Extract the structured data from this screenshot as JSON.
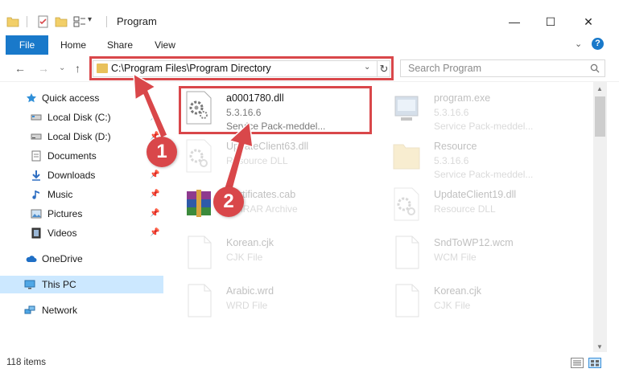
{
  "window": {
    "title": "Program",
    "minimize_glyph": "—",
    "maximize_glyph": "☐",
    "close_glyph": "✕"
  },
  "ribbon": {
    "tabs": [
      "File",
      "Home",
      "Share",
      "View"
    ],
    "collapse_glyph": "⌄",
    "help_glyph": "?"
  },
  "nav": {
    "back_glyph": "←",
    "forward_glyph": "→",
    "recent_glyph": "⌄",
    "up_glyph": "↑",
    "address_path": "C:\\Program Files\\Program Directory",
    "address_dropdown_glyph": "⌄",
    "refresh_glyph": "↻",
    "search_placeholder": "Search Program"
  },
  "sidebar": {
    "items": [
      {
        "label": "Quick access",
        "icon": "star-icon"
      },
      {
        "label": "Local Disk (C:)",
        "icon": "drive-icon"
      },
      {
        "label": "Local Disk (D:)",
        "icon": "drive-icon"
      },
      {
        "label": "Documents",
        "icon": "documents-icon"
      },
      {
        "label": "Downloads",
        "icon": "download-icon"
      },
      {
        "label": "Music",
        "icon": "music-icon"
      },
      {
        "label": "Pictures",
        "icon": "pictures-icon"
      },
      {
        "label": "Videos",
        "icon": "videos-icon"
      },
      {
        "label": "OneDrive",
        "icon": "cloud-icon"
      },
      {
        "label": "This PC",
        "icon": "monitor-icon"
      },
      {
        "label": "Network",
        "icon": "network-icon"
      }
    ],
    "pin_glyph": "📌"
  },
  "files": [
    {
      "name": "a0001780.dll",
      "line2": "5.3.16.6",
      "line3": "Service Pack-meddel...",
      "icon": "dll-gear-icon"
    },
    {
      "name": "program.exe",
      "line2": "5.3.16.6",
      "line3": "Service Pack-meddel...",
      "icon": "exe-icon"
    },
    {
      "name": "UpdateClient63.dll",
      "line2": "Resource DLL",
      "line3": "",
      "icon": "dll-gear-icon"
    },
    {
      "name": "Resource",
      "line2": "5.3.16.6",
      "line3": "Service Pack-meddel...",
      "icon": "folder-icon"
    },
    {
      "name": "Certificates.cab",
      "line2": "WinRAR Archive",
      "line3": "",
      "icon": "archive-icon"
    },
    {
      "name": "UpdateClient19.dll",
      "line2": "Resource DLL",
      "line3": "",
      "icon": "dll-gear-icon"
    },
    {
      "name": "Korean.cjk",
      "line2": "CJK File",
      "line3": "",
      "icon": "blank-file-icon"
    },
    {
      "name": "SndToWP12.wcm",
      "line2": "WCM File",
      "line3": "",
      "icon": "blank-file-icon"
    },
    {
      "name": "Arabic.wrd",
      "line2": "WRD File",
      "line3": "",
      "icon": "blank-file-icon"
    },
    {
      "name": "Korean.cjk",
      "line2": "CJK File",
      "line3": "",
      "icon": "blank-file-icon"
    }
  ],
  "status": {
    "item_count": "118 items"
  },
  "annotations": {
    "badge1": "1",
    "badge2": "2",
    "color": "#d9474a"
  },
  "colors": {
    "accent": "#1979ca",
    "selection": "#cce8ff",
    "folder": "#e8c15b"
  }
}
